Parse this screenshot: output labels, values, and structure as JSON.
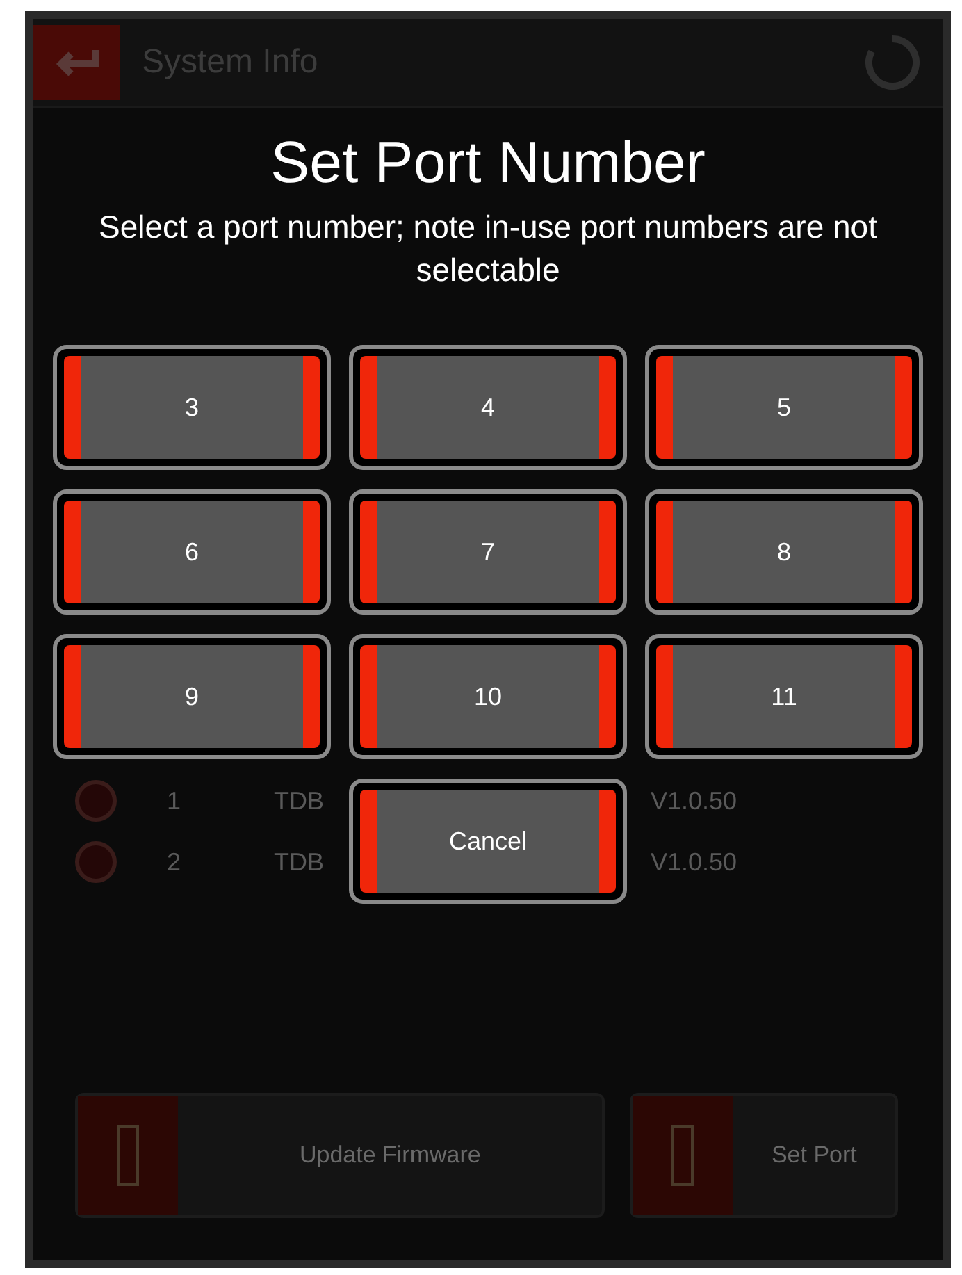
{
  "header": {
    "title": "System Info"
  },
  "devices": [
    {
      "index": "1",
      "name": "TDB",
      "version": "V1.0.50",
      "selected": false
    },
    {
      "index": "2",
      "name": "TDB",
      "version": "V1.0.50",
      "selected": false
    }
  ],
  "actions": [
    "Update Firmware",
    "Set Port"
  ],
  "dialog": {
    "title": "Set Port Number",
    "message": "Select a port number; note in-use port numbers are not selectable",
    "ports": [
      "3",
      "4",
      "5",
      "6",
      "7",
      "8",
      "9",
      "10",
      "11"
    ],
    "cancel": "Cancel"
  }
}
